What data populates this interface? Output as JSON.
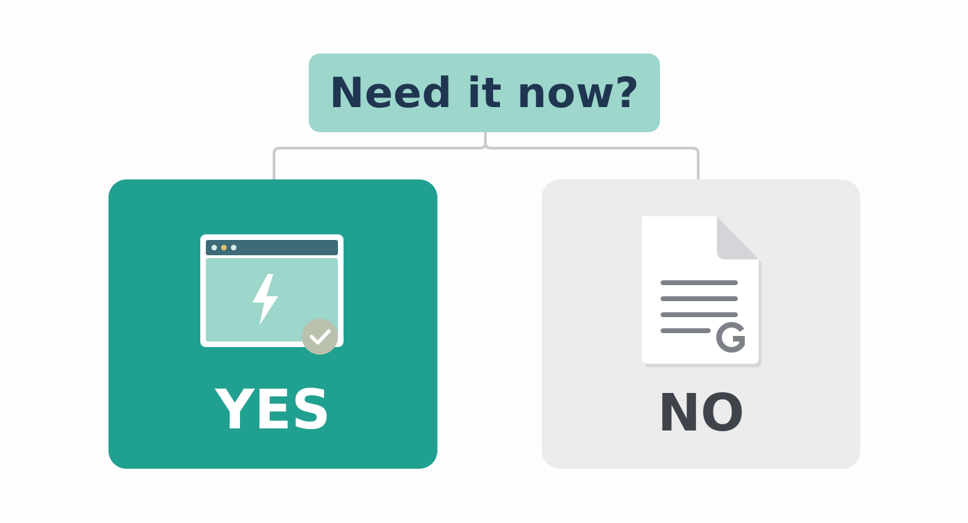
{
  "question": {
    "text": "Need it now?"
  },
  "options": {
    "yes": {
      "label": "YES",
      "icon": "instant-app-window-icon",
      "badge_icon": "check-badge-icon"
    },
    "no": {
      "label": "NO",
      "icon": "document-icon",
      "badge_icon": "g-logo-icon"
    }
  },
  "colors": {
    "question_bg": "#9dd6cb",
    "question_text": "#1f3550",
    "yes_bg": "#20a090",
    "yes_text": "#ffffff",
    "no_bg": "#ececed",
    "no_text": "#3e444a",
    "connector": "#c9cbcd"
  }
}
